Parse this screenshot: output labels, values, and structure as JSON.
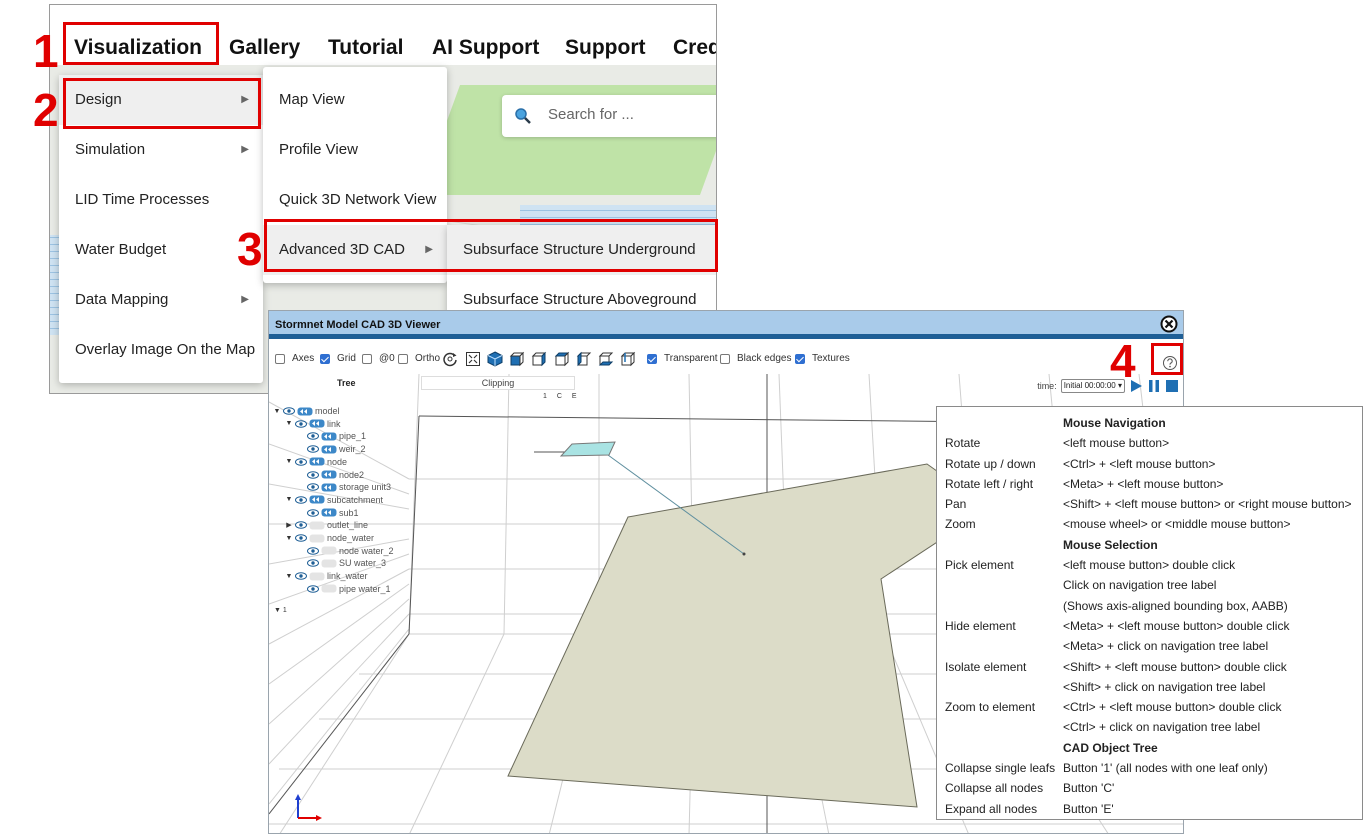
{
  "nav": {
    "items": [
      "Visualization",
      "Gallery",
      "Tutorial",
      "AI Support",
      "Support",
      "Cred"
    ]
  },
  "menu1": {
    "items": [
      {
        "label": "Design",
        "submenu": true
      },
      {
        "label": "Simulation",
        "submenu": true
      },
      {
        "label": "LID Time Processes",
        "submenu": false
      },
      {
        "label": "Water Budget",
        "submenu": false
      },
      {
        "label": "Data Mapping",
        "submenu": true
      },
      {
        "label": "Overlay Image On the Map",
        "submenu": false
      }
    ]
  },
  "menu2": {
    "items": [
      {
        "label": "Map View",
        "submenu": false
      },
      {
        "label": "Profile View",
        "submenu": false
      },
      {
        "label": "Quick 3D Network View",
        "submenu": false
      },
      {
        "label": "Advanced 3D CAD",
        "submenu": true
      }
    ]
  },
  "menu3": {
    "items": [
      {
        "label": "Subsurface Structure Underground"
      },
      {
        "label": "Subsurface Structure Aboveground"
      }
    ]
  },
  "search": {
    "placeholder": "Search for ..."
  },
  "steps": [
    "1",
    "2",
    "3",
    "4"
  ],
  "cad": {
    "title": "Stormnet Model CAD 3D Viewer",
    "toolbar": {
      "axes": {
        "label": "Axes",
        "checked": false
      },
      "grid": {
        "label": "Grid",
        "checked": true
      },
      "at0": {
        "label": "@0",
        "checked": false
      },
      "ortho": {
        "label": "Ortho",
        "checked": false
      },
      "transparent": {
        "label": "Transparent",
        "checked": true
      },
      "black_edges": {
        "label": "Black edges",
        "checked": false
      },
      "textures": {
        "label": "Textures",
        "checked": true
      }
    },
    "tree_header": "Tree",
    "clipping_header": "Clipping",
    "tree_commands": "1 C E",
    "tree_collapsed_marker": "1",
    "tree": [
      {
        "label": "model",
        "level": 0,
        "arrow": "▼"
      },
      {
        "label": "link",
        "level": 1,
        "arrow": "▼"
      },
      {
        "label": "pipe_1",
        "level": 2,
        "arrow": ""
      },
      {
        "label": "weir_2",
        "level": 2,
        "arrow": ""
      },
      {
        "label": "node",
        "level": 1,
        "arrow": "▼"
      },
      {
        "label": "node2",
        "level": 2,
        "arrow": ""
      },
      {
        "label": "storage unit3",
        "level": 2,
        "arrow": ""
      },
      {
        "label": "subcatchment",
        "level": 1,
        "arrow": "▼"
      },
      {
        "label": "sub1",
        "level": 2,
        "arrow": ""
      },
      {
        "label": "outlet_line",
        "level": 1,
        "arrow": "▶"
      },
      {
        "label": "node_water",
        "level": 1,
        "arrow": "▼"
      },
      {
        "label": "node water_2",
        "level": 2,
        "arrow": ""
      },
      {
        "label": "SU water_3",
        "level": 2,
        "arrow": ""
      },
      {
        "label": "link_water",
        "level": 1,
        "arrow": "▼"
      },
      {
        "label": "pipe water_1",
        "level": 2,
        "arrow": ""
      }
    ],
    "time_label": "time:",
    "time_value": "Initial 00:00:00"
  },
  "help": {
    "rows": [
      {
        "type": "h",
        "v": "Mouse Navigation"
      },
      {
        "k": "Rotate",
        "v": "<left mouse button>"
      },
      {
        "k": "Rotate up / down",
        "v": "<Ctrl> + <left mouse button>"
      },
      {
        "k": "Rotate left / right",
        "v": "<Meta> + <left mouse button>"
      },
      {
        "k": "Pan",
        "v": "<Shift> + <left mouse button> or <right mouse button>"
      },
      {
        "k": "Zoom",
        "v": "<mouse wheel> or <middle mouse button>"
      },
      {
        "type": "h",
        "v": "Mouse Selection"
      },
      {
        "k": "Pick element",
        "v": "<left mouse button> double click"
      },
      {
        "k": "",
        "v": "Click on navigation tree label"
      },
      {
        "k": "",
        "v": "(Shows axis-aligned bounding box, AABB)"
      },
      {
        "k": "Hide element",
        "v": "<Meta> + <left mouse button> double click"
      },
      {
        "k": "",
        "v": "<Meta> + click on navigation tree label"
      },
      {
        "k": "Isolate element",
        "v": "<Shift> + <left mouse button> double click"
      },
      {
        "k": "",
        "v": "<Shift> + click on navigation tree label"
      },
      {
        "k": "Zoom to element",
        "v": "<Ctrl> + <left mouse button> double click"
      },
      {
        "k": "",
        "v": "<Ctrl> + click on navigation tree label"
      },
      {
        "type": "h",
        "v": "CAD Object Tree"
      },
      {
        "k": "Collapse single leafs",
        "v": "Button '1' (all nodes with one leaf only)"
      },
      {
        "k": "Collapse all nodes",
        "v": "Button 'C'"
      },
      {
        "k": "Expand all nodes",
        "v": "Button 'E'"
      }
    ]
  },
  "colors": {
    "callout": "#e00000",
    "titlebar": "#a9cbea",
    "titlebar_border": "#1f5f96",
    "polygon": "#dcdcc8"
  }
}
